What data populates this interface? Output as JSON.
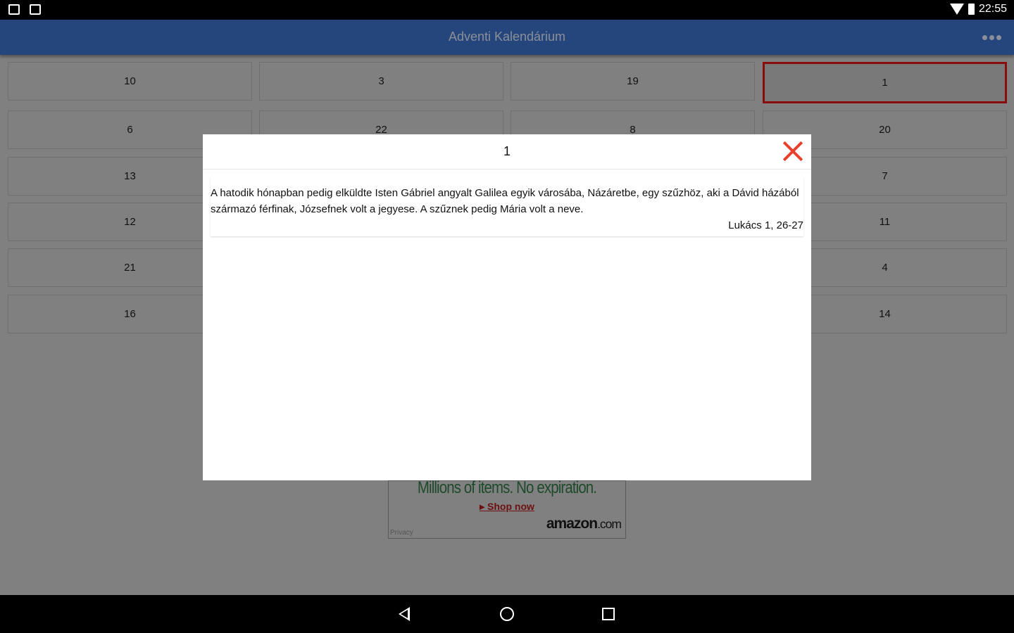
{
  "status": {
    "time": "22:55",
    "left_icons": [
      "gmail-icon",
      "image-icon"
    ]
  },
  "appbar": {
    "title": "Adventi Kalendárium",
    "menu_icon": "more-dots-icon"
  },
  "grid": {
    "cells": [
      [
        "10",
        "3",
        "19",
        "1"
      ],
      [
        "6",
        "22",
        "8",
        "20"
      ],
      [
        "13",
        "",
        "",
        "7"
      ],
      [
        "12",
        "",
        "",
        "11"
      ],
      [
        "21",
        "",
        "",
        "4"
      ],
      [
        "16",
        "",
        "",
        "14"
      ]
    ],
    "selected": "1",
    "selected_color": "#8a0d0d"
  },
  "ad": {
    "headline": "Millions of items. No expiration.",
    "cta": "Shop now",
    "brand": "amazon",
    "brand_suffix": ".com",
    "privacy": "Privacy"
  },
  "dialog": {
    "title": "1",
    "text": "A hatodik hónapban pedig elküldte Isten Gábriel angyalt Galilea egyik városába, Názáretbe, egy szűzhöz, aki a Dávid házából származó férfinak, Józsefnek volt a jegyese. A szűznek pedig Mária volt a neve.",
    "reference": "Lukács 1, 26-27",
    "close_color": "#e8402a"
  }
}
